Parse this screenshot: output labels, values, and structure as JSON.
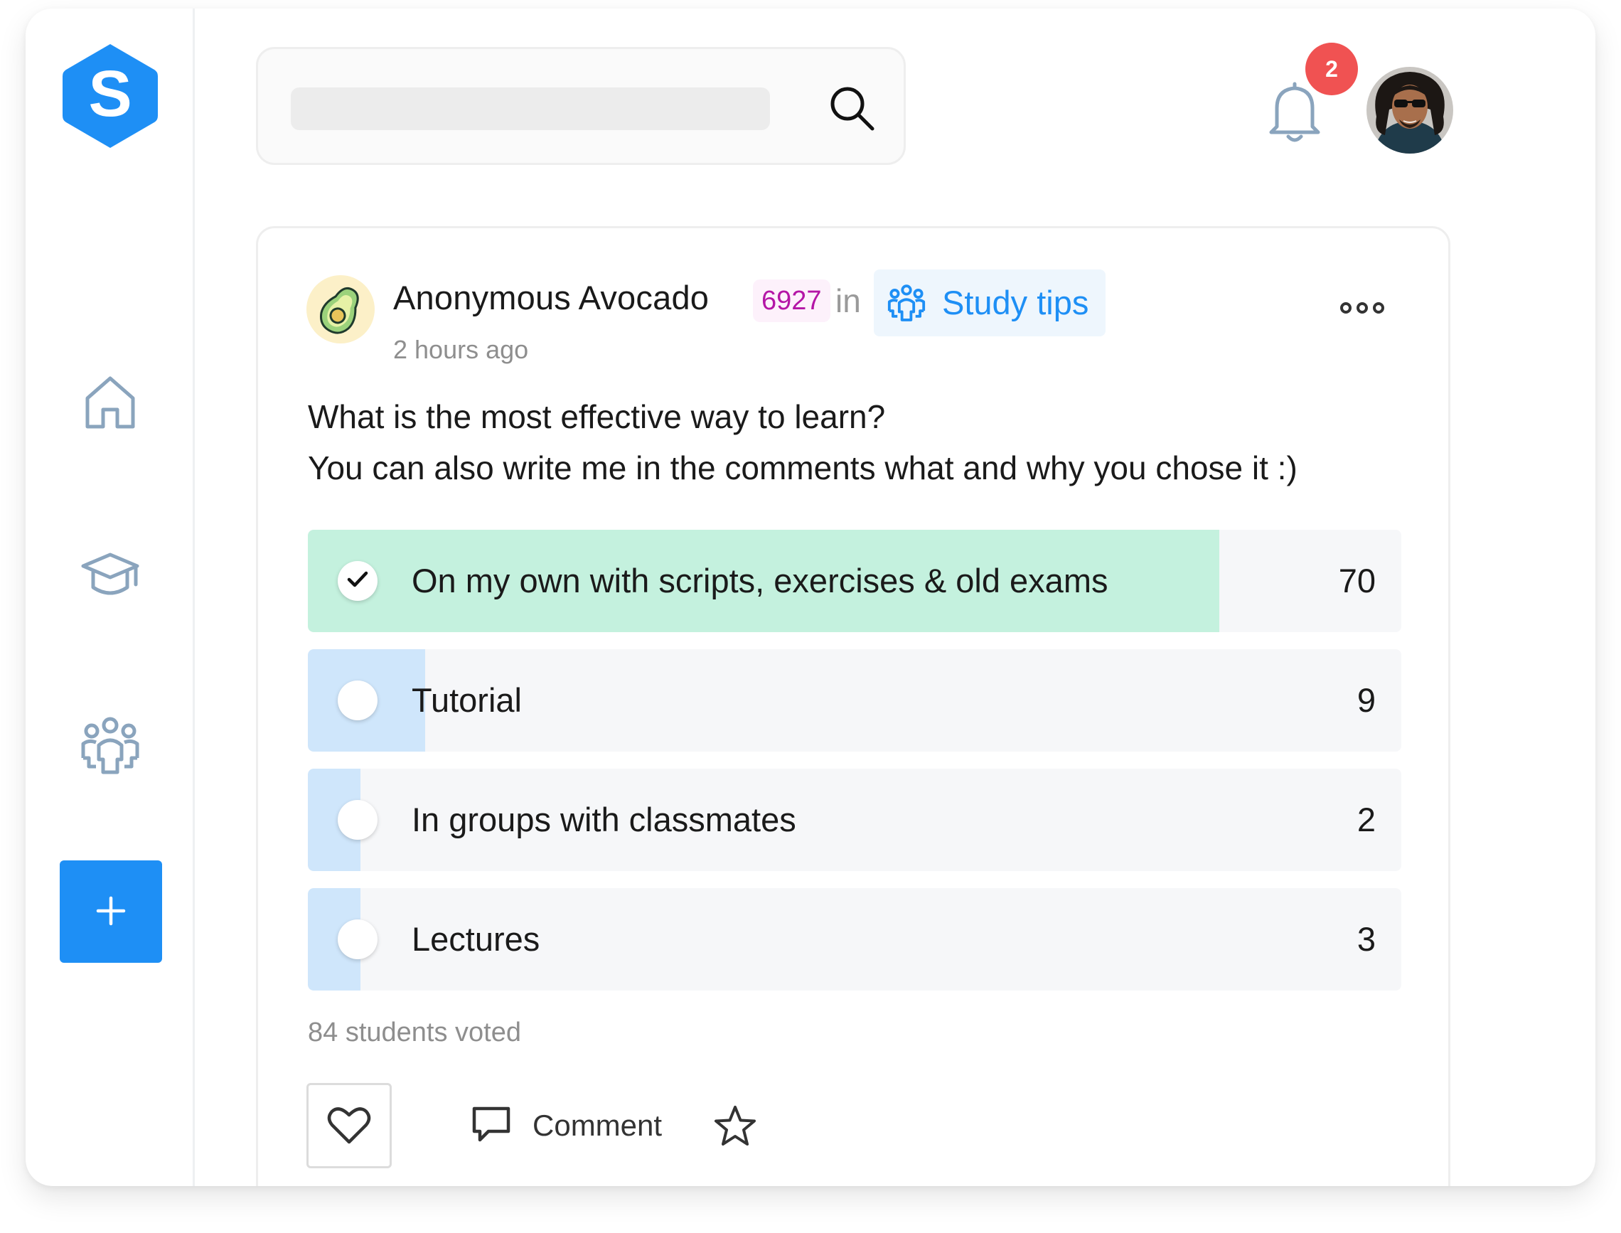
{
  "app": {
    "logo_letter": "S",
    "accent": "#1e8ff5"
  },
  "sidebar": {
    "items": [
      {
        "icon": "home-icon"
      },
      {
        "icon": "graduation-cap-icon"
      },
      {
        "icon": "groups-icon"
      }
    ],
    "add_icon": "plus-icon"
  },
  "search": {
    "placeholder": "",
    "icon": "search-icon"
  },
  "notifications": {
    "count": "2",
    "icon": "bell-icon"
  },
  "post": {
    "author": "Anonymous Avocado",
    "karma": "6927",
    "in_word": "in",
    "group": "Study tips",
    "time": "2 hours ago",
    "question_line1": "What is the most effective way to learn?",
    "question_line2": "You can also write me in the comments what and why you chose it :)",
    "options": [
      {
        "label": "On my own with scripts, exercises & old exams",
        "count": "70",
        "selected": true,
        "fill_color": "#c4f1de"
      },
      {
        "label": "Tutorial",
        "count": "9",
        "selected": false,
        "fill_color": "#cfe6fb"
      },
      {
        "label": "In groups with classmates",
        "count": "2",
        "selected": false,
        "fill_color": "#cfe6fb"
      },
      {
        "label": "Lectures",
        "count": "3",
        "selected": false,
        "fill_color": "#cfe6fb"
      }
    ],
    "votes_text": "84 students voted",
    "comment_label": "Comment"
  }
}
